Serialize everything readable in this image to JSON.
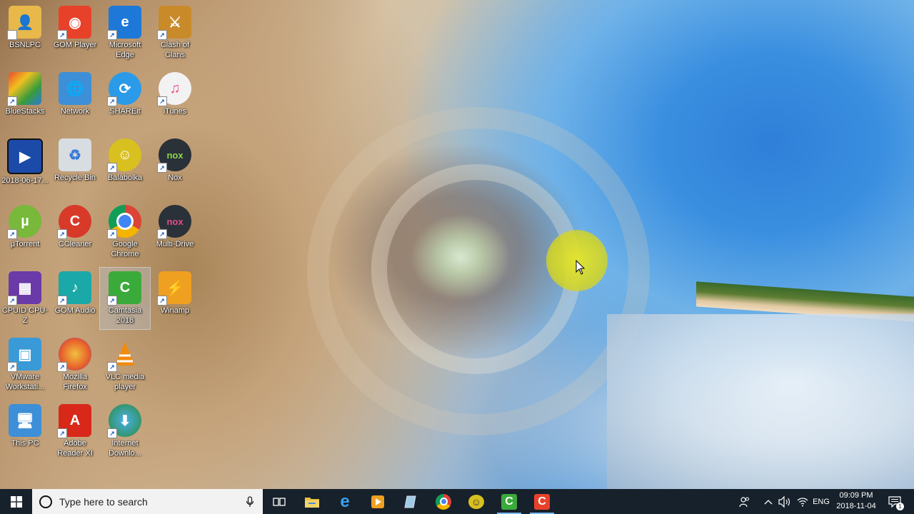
{
  "desktop": {
    "icons": [
      {
        "label": "BSNLPC",
        "icon": "user-folder-icon",
        "color": "#e8b84a"
      },
      {
        "label": "GOM Player",
        "icon": "gom-player-icon",
        "color": "#e8412a"
      },
      {
        "label": "Microsoft Edge",
        "icon": "edge-icon",
        "color": "#1e78d7"
      },
      {
        "label": "Clash of Clans",
        "icon": "clash-of-clans-icon",
        "color": "#c98b2a"
      },
      {
        "label": "BlueStacks",
        "icon": "bluestacks-icon",
        "color": "#3a9c3a"
      },
      {
        "label": "Network",
        "icon": "network-icon",
        "color": "#3d8fd8"
      },
      {
        "label": "SHAREit",
        "icon": "shareit-icon",
        "color": "#2b9ae8"
      },
      {
        "label": "iTunes",
        "icon": "itunes-icon",
        "color": "#f2f2f2"
      },
      {
        "label": "2018-06-17...",
        "icon": "video-file-icon",
        "color": "#1c4aa8"
      },
      {
        "label": "Recycle Bin",
        "icon": "recycle-bin-icon",
        "color": "#d8dde2"
      },
      {
        "label": "Balabolka",
        "icon": "balabolka-icon",
        "color": "#d8c020"
      },
      {
        "label": "Nox",
        "icon": "nox-icon",
        "color": "#2a3138"
      },
      {
        "label": "µTorrent",
        "icon": "utorrent-icon",
        "color": "#78b83a"
      },
      {
        "label": "CCleaner",
        "icon": "ccleaner-icon",
        "color": "#d83a2a"
      },
      {
        "label": "Google Chrome",
        "icon": "chrome-icon",
        "color": "#2f9a4a"
      },
      {
        "label": "Multi-Drive",
        "icon": "multi-drive-icon",
        "color": "#2a3138"
      },
      {
        "label": "CPUID CPU-Z",
        "icon": "cpuz-icon",
        "color": "#6a3aa8"
      },
      {
        "label": "GOM Audio",
        "icon": "gom-audio-icon",
        "color": "#1aa8a8"
      },
      {
        "label": "Camtasia 2018",
        "icon": "camtasia-icon",
        "color": "#3aaa3a"
      },
      {
        "label": "Winamp",
        "icon": "winamp-icon",
        "color": "#f0a020"
      },
      {
        "label": "VMware Workstati...",
        "icon": "vmware-icon",
        "color": "#3a9ad8"
      },
      {
        "label": "Mozilla Firefox",
        "icon": "firefox-icon",
        "color": "#e8602a"
      },
      {
        "label": "VLC media player",
        "icon": "vlc-icon",
        "color": "#f08a10"
      },
      {
        "label": "This PC",
        "icon": "this-pc-icon",
        "color": "#3d8fd8"
      },
      {
        "label": "Adobe Reader XI",
        "icon": "adobe-reader-icon",
        "color": "#d8281a"
      },
      {
        "label": "Internet Downlo...",
        "icon": "internet-download-manager-icon",
        "color": "#2a8a3a"
      }
    ]
  },
  "taskbar": {
    "search_placeholder": "Type here to search",
    "pinned": [
      {
        "name": "task-view",
        "icon": "task-view-icon"
      },
      {
        "name": "file-explorer",
        "icon": "folder-icon",
        "color": "#f0c040"
      },
      {
        "name": "edge",
        "icon": "edge-icon",
        "color": "#1e78d7"
      },
      {
        "name": "media-player",
        "icon": "media-player-icon",
        "color": "#f0a020"
      },
      {
        "name": "notepad",
        "icon": "notepad-icon",
        "color": "#9ecbe8"
      },
      {
        "name": "chrome",
        "icon": "chrome-icon",
        "color": "#2f9a4a"
      },
      {
        "name": "balabolka",
        "icon": "balabolka-icon",
        "color": "#d8c020"
      },
      {
        "name": "camtasia",
        "icon": "camtasia-icon",
        "color": "#3aaa3a"
      },
      {
        "name": "camtasia-recorder",
        "icon": "camtasia-recorder-icon",
        "color": "#e8412a"
      }
    ],
    "tray": {
      "language": "ENG",
      "time": "09:09 PM",
      "date": "2018-11-04",
      "notification_count": "1"
    }
  }
}
